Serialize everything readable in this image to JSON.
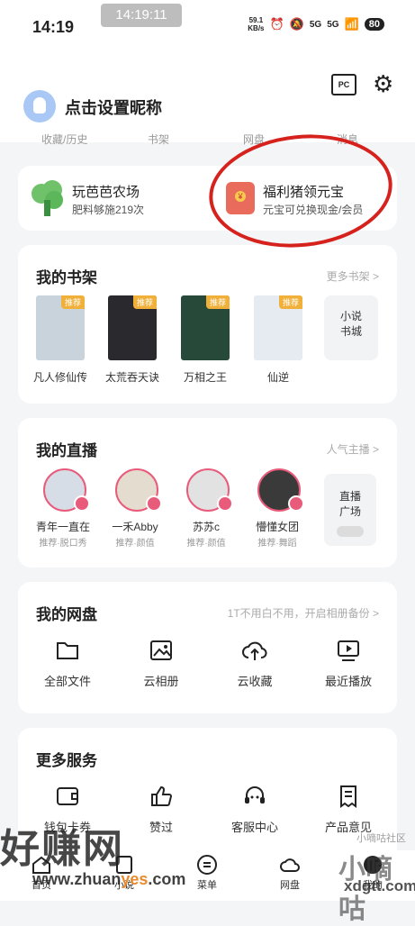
{
  "status_bar": {
    "time": "14:19",
    "clock_overlay": "14:19:11",
    "net_speed": "59.1",
    "net_unit": "KB/s",
    "signal1": "5G",
    "signal2": "5G",
    "battery": "80"
  },
  "profile": {
    "nickname": "点击设置昵称",
    "pc_label": "PC"
  },
  "subnav": [
    "收藏/历史",
    "书架",
    "网盘",
    "消息"
  ],
  "promos": [
    {
      "title": "玩芭芭农场",
      "subtitle": "肥料够施219次"
    },
    {
      "title": "福利猪领元宝",
      "subtitle": "元宝可兑换现金/会员"
    }
  ],
  "bookshelf": {
    "title": "我的书架",
    "more": "更多书架 >",
    "tag": "推荐",
    "books": [
      {
        "name": "凡人修仙传",
        "cover_color": "#c9d3dc",
        "cover_text": "凡人修仙传"
      },
      {
        "name": "太荒吞天诀",
        "cover_color": "#2a2a2e",
        "cover_text": "太荒吞天诀"
      },
      {
        "name": "万相之王",
        "cover_color": "#27493a",
        "cover_text": "万相之王"
      },
      {
        "name": "仙逆",
        "cover_color": "#e6ebf2",
        "cover_text": "仙逆"
      }
    ],
    "more_box": {
      "line1": "小说",
      "line2": "书城"
    }
  },
  "live": {
    "title": "我的直播",
    "more": "人气主播 >",
    "streamers": [
      {
        "name": "青年一直在",
        "tag": "推荐·脱口秀"
      },
      {
        "name": "一禾Abby",
        "tag": "推荐·颜值"
      },
      {
        "name": "苏苏c",
        "tag": "推荐·颜值"
      },
      {
        "name": "懵懂女团",
        "tag": "推荐·舞蹈"
      }
    ],
    "more_box": {
      "line1": "直播",
      "line2": "广场"
    }
  },
  "netdisk": {
    "title": "我的网盘",
    "more": "1T不用白不用，开启相册备份 >",
    "tools": [
      {
        "label": "全部文件",
        "icon": "folder-icon"
      },
      {
        "label": "云相册",
        "icon": "photo-album-icon"
      },
      {
        "label": "云收藏",
        "icon": "cloud-upload-icon"
      },
      {
        "label": "最近播放",
        "icon": "video-play-icon"
      }
    ]
  },
  "services": {
    "title": "更多服务",
    "tools": [
      {
        "label": "钱包卡券",
        "icon": "wallet-icon"
      },
      {
        "label": "赞过",
        "icon": "thumbs-up-icon"
      },
      {
        "label": "客服中心",
        "icon": "headset-icon"
      },
      {
        "label": "产品意见",
        "icon": "feedback-icon"
      }
    ]
  },
  "tabs": [
    "首页",
    "小说",
    "菜单",
    "网盘",
    "我的"
  ],
  "watermark": {
    "main": "好赚网",
    "url_a": "www.zhuan",
    "url_b": "yes",
    "url_c": ".com",
    "right_small": "小嘀咕社区",
    "right_big": "小嘀咕",
    "right_url": "xdgtt.com"
  },
  "colors": {
    "accent_red": "#d6221d",
    "live_ring": "#e85b7a",
    "tag_orange": "#f0b03a"
  }
}
